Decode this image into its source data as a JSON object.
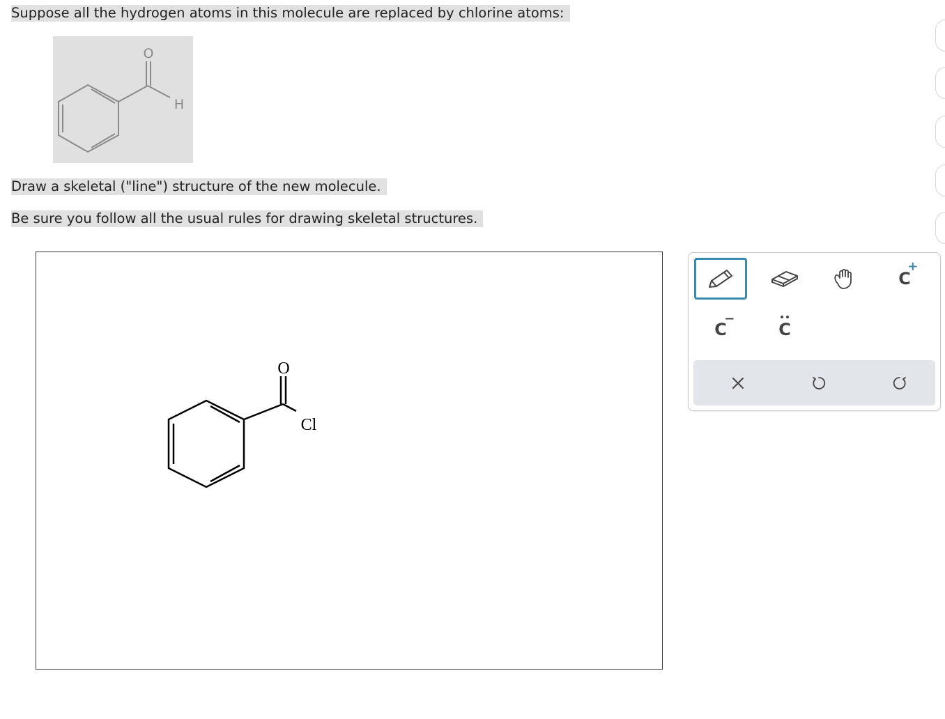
{
  "question": {
    "line1": "Suppose all the hydrogen atoms in this molecule are replaced by chlorine atoms:",
    "line2": "Draw a skeletal (\"line\") structure of the new molecule.",
    "line3": "Be sure you follow all the usual rules for drawing skeletal structures."
  },
  "given_molecule": {
    "oxygen_label": "O",
    "hydrogen_label": "H"
  },
  "drawing": {
    "oxygen_label": "O",
    "chlorine_label": "Cl"
  },
  "toolbar": {
    "tools": [
      {
        "name": "pencil-icon",
        "active": true
      },
      {
        "name": "eraser-icon",
        "active": false
      },
      {
        "name": "hand-icon",
        "active": false
      },
      {
        "name": "carbocation-icon",
        "active": false
      },
      {
        "name": "carbanion-icon",
        "active": false
      },
      {
        "name": "lone-pair-icon",
        "active": false
      }
    ],
    "charge_labels": {
      "carbocation": "C",
      "carbocation_sup": "+",
      "carbanion": "C",
      "carbanion_sup": "−",
      "lone_pair": "C"
    },
    "actions": [
      "clear-icon",
      "undo-icon",
      "redo-icon"
    ],
    "accent_color": "#3a8ab0",
    "action_bar_color": "#e2e6ea"
  }
}
